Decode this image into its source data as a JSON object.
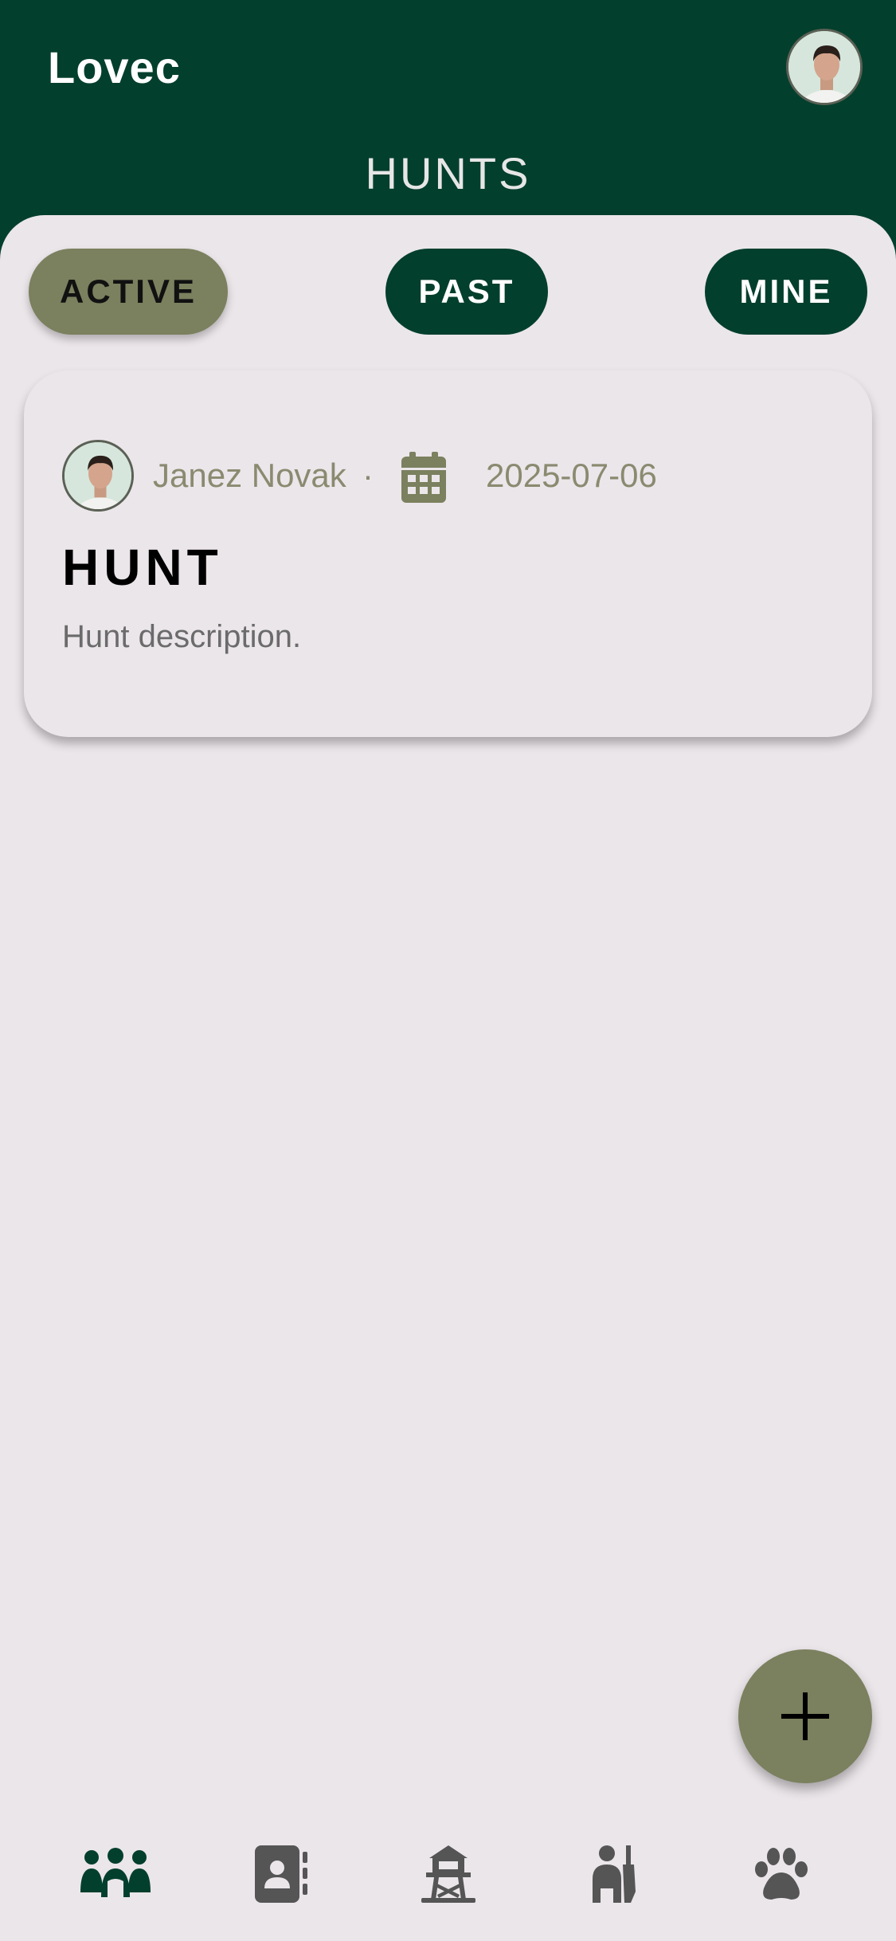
{
  "app": {
    "title": "Lovec"
  },
  "header": {
    "page_title": "HUNTS"
  },
  "filters": {
    "active_label": "ACTIVE",
    "past_label": "PAST",
    "mine_label": "MINE",
    "selected": "ACTIVE"
  },
  "cards": [
    {
      "author": "Janez Novak",
      "separator": "·",
      "date": "2025-07-06",
      "title": "HUNT",
      "description": "Hunt description."
    }
  ],
  "bottom_nav": [
    {
      "icon": "people-group-icon",
      "selected": true
    },
    {
      "icon": "contacts-book-icon",
      "selected": false
    },
    {
      "icon": "hunting-tower-icon",
      "selected": false
    },
    {
      "icon": "hunter-icon",
      "selected": false
    },
    {
      "icon": "paw-icon",
      "selected": false
    }
  ],
  "colors": {
    "primary": "#033f2d",
    "accent": "#7b805e",
    "surface": "#ebe6ea",
    "nav_icon": "#555555"
  }
}
